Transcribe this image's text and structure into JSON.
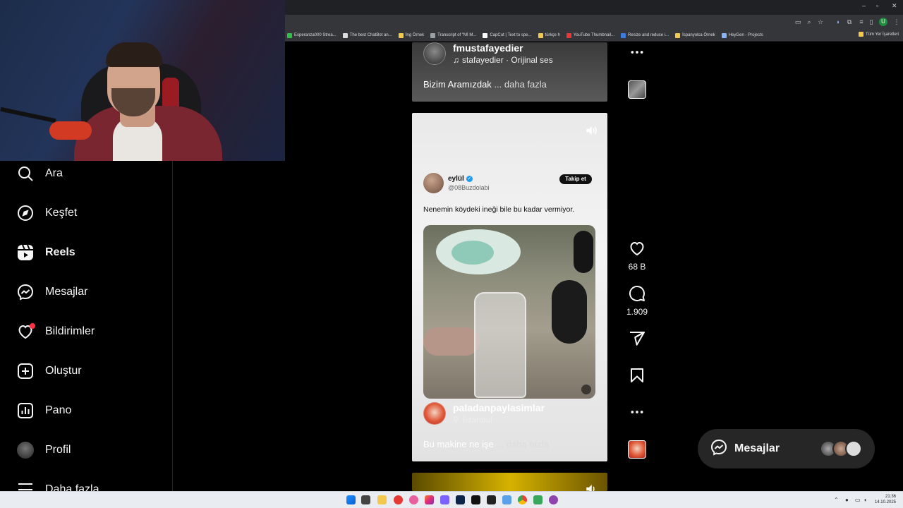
{
  "browser": {
    "bookmarks": [
      {
        "label": "Esperanza000 Strea...",
        "color": "#2fbf4a"
      },
      {
        "label": "The best ChatBot an...",
        "color": "#dddddd"
      },
      {
        "label": "İng Örnek",
        "color": "#f2c94c"
      },
      {
        "label": "Transcript of \"Mİ M...",
        "color": "#9aa0a6"
      },
      {
        "label": "CapCut | Text to spe...",
        "color": "#ffffff"
      },
      {
        "label": "türkçe h",
        "color": "#f2c94c"
      },
      {
        "label": "YouTube Thumbnail...",
        "color": "#e53935"
      },
      {
        "label": "Resize and reduce i...",
        "color": "#3b7ddd"
      },
      {
        "label": "İspanyolca Örnek",
        "color": "#f2c94c"
      },
      {
        "label": "HeyGen - Projects",
        "color": "#8ab4f8"
      }
    ],
    "all_bookmarks": "Tüm Yer İşaretleri",
    "profile_initial": "U"
  },
  "sidebar": {
    "items": [
      {
        "label": "Ara",
        "icon": "search-icon"
      },
      {
        "label": "Keşfet",
        "icon": "compass-icon"
      },
      {
        "label": "Reels",
        "icon": "reels-icon"
      },
      {
        "label": "Mesajlar",
        "icon": "messenger-icon"
      },
      {
        "label": "Bildirimler",
        "icon": "heart-icon"
      },
      {
        "label": "Oluştur",
        "icon": "plus-square-icon"
      },
      {
        "label": "Pano",
        "icon": "dashboard-icon"
      },
      {
        "label": "Profil",
        "icon": "avatar"
      },
      {
        "label": "Daha fazla",
        "icon": "menu-icon"
      }
    ]
  },
  "reel_top": {
    "author": "fmustafayedier",
    "audio": "stafayedier · Orijinal ses",
    "caption": "Bizim Aramızdak",
    "more": "... daha fazla"
  },
  "reel_main": {
    "tweet": {
      "name": "eylül",
      "handle": "@08Buzdolabi",
      "follow": "Takip et",
      "text": "Nenemin köydeki ineği bile bu kadar vermiyor."
    },
    "author": "paladanpaylasimlar",
    "location": "İstanbul",
    "caption": "Bu makine ne işe",
    "more": "... daha fazla"
  },
  "actions": {
    "likes": "68 B",
    "comments": "1.909"
  },
  "messages_pill": {
    "label": "Mesajlar"
  },
  "taskbar": {
    "time": "21:36",
    "date": "14.10.2025"
  },
  "colors": {
    "accent_red": "#ff3040",
    "background": "#000000"
  }
}
